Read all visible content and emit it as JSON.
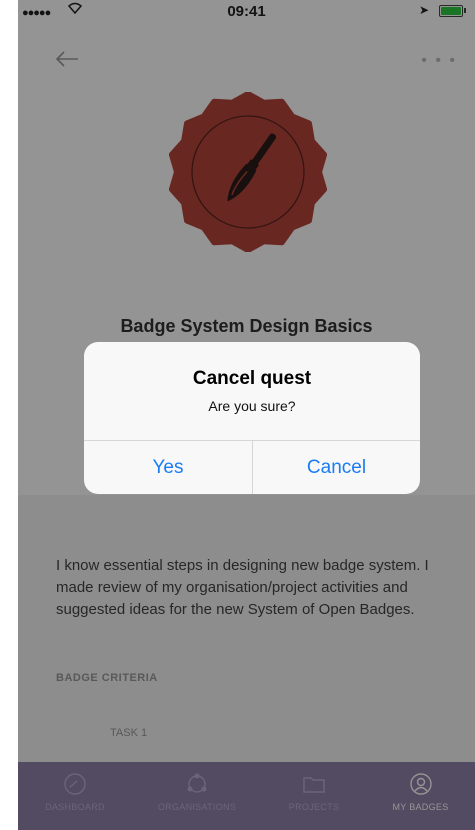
{
  "status_bar": {
    "signal": "●●●●●",
    "time": "09:41"
  },
  "badge": {
    "title": "Badge System Design Basics",
    "color": "#b6443a"
  },
  "description": "I know essential steps in designing new badge system. I made review of my organisation/project activities and suggested ideas for the new System of Open Badges.",
  "criteria_header": "BADGE CRITERIA",
  "task_label": "TASK 1",
  "tab_bar": {
    "tabs": [
      {
        "label": "DASHBOARD",
        "icon": "dashboard-icon"
      },
      {
        "label": "ORGANISATIONS",
        "icon": "organisations-icon"
      },
      {
        "label": "PROJECTS",
        "icon": "folder-icon"
      },
      {
        "label": "MY BADGES",
        "icon": "badge-icon",
        "active": true
      }
    ]
  },
  "alert": {
    "title": "Cancel quest",
    "message": "Are you sure?",
    "confirm_label": "Yes",
    "cancel_label": "Cancel",
    "button_color": "#1a7cf5"
  }
}
